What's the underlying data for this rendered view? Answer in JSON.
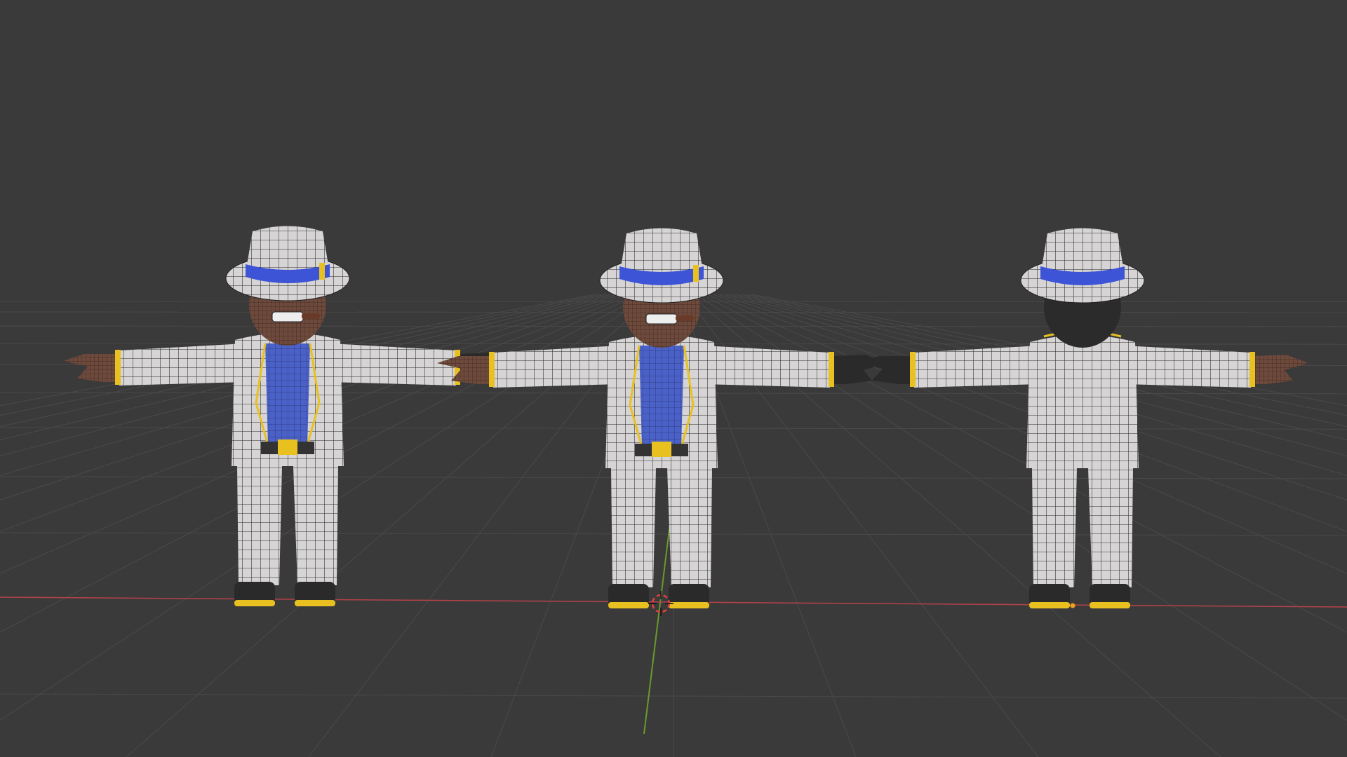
{
  "viewport": {
    "background": "#3a3a3a",
    "grid_color": "#4a4a4a",
    "x_axis_color": "#b5424a",
    "y_axis_color": "#6a9a2a",
    "cursor_color": "#e04040",
    "origin_color": "#f0a020"
  },
  "characters": [
    {
      "view": "front-left",
      "show_face": true
    },
    {
      "view": "front",
      "show_face": true
    },
    {
      "view": "back",
      "show_face": false
    }
  ],
  "materials": {
    "suit": "#d6d4d4",
    "wire": "#2a2a2a",
    "skin": "#6e4a3c",
    "shirt": "#4a62c8",
    "shirt_accent": "#38b0b8",
    "hat_band": "#3d54d6",
    "gold": "#e8c020",
    "shoe": "#2a2a2a",
    "hair": "#2b2b2b"
  }
}
